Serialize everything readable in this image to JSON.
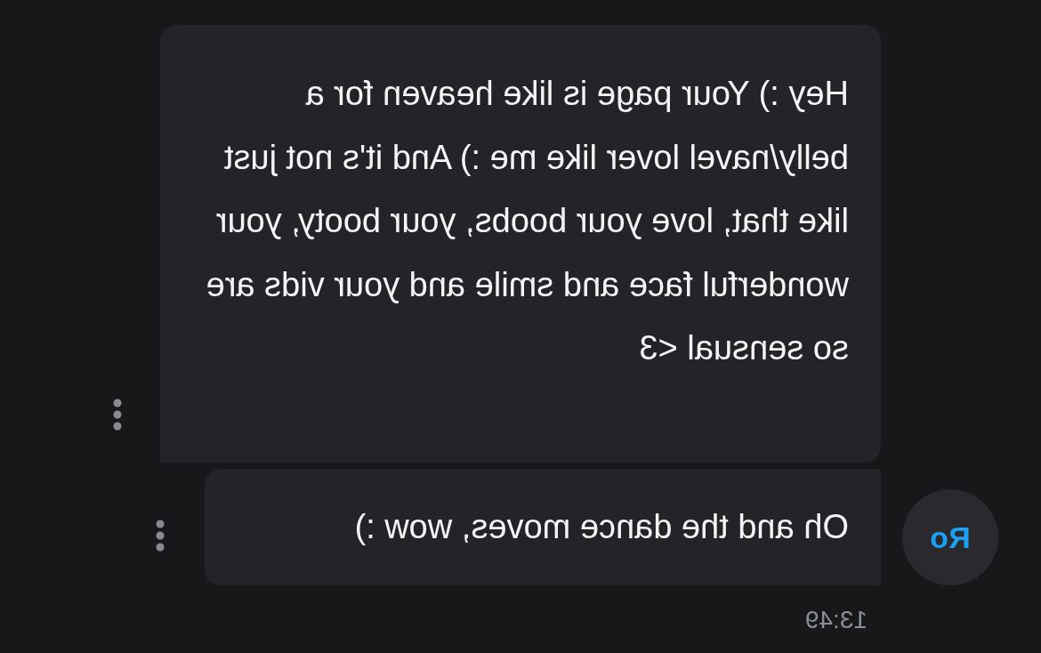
{
  "messages": [
    {
      "text": "Hey :) Your page is like heaven for a belly/navel lover like me :) And it's not just like that, love your boobs, your booty, your wonderful face and smile and your vids are so sensual <3"
    },
    {
      "text": "Oh and the dance moves, wow :)"
    }
  ],
  "sender": {
    "initials": "Ro"
  },
  "time": "13:49"
}
